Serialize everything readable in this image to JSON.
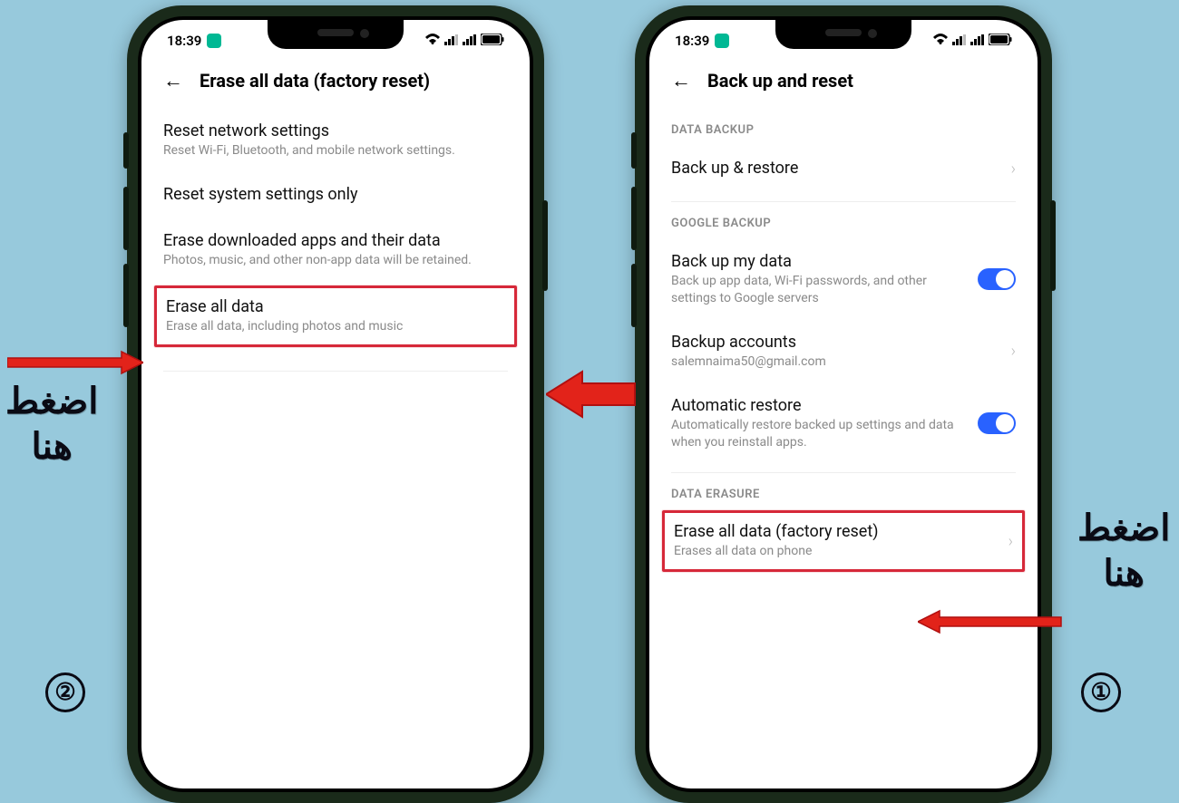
{
  "status": {
    "time": "18:39"
  },
  "phone_left": {
    "header": "Erase all data (factory reset)",
    "items": [
      {
        "title": "Reset network settings",
        "sub": "Reset Wi-Fi, Bluetooth, and mobile network settings."
      },
      {
        "title": "Reset system settings only",
        "sub": ""
      },
      {
        "title": "Erase downloaded apps and their data",
        "sub": "Photos, music, and other non-app data will be retained."
      },
      {
        "title": "Erase all data",
        "sub": "Erase all data, including photos and music"
      }
    ]
  },
  "phone_right": {
    "header": "Back up and reset",
    "sections": {
      "data_backup": "DATA BACKUP",
      "google_backup": "GOOGLE BACKUP",
      "data_erasure": "DATA ERASURE"
    },
    "backup_restore": {
      "title": "Back up & restore"
    },
    "backup_my_data": {
      "title": "Back up my data",
      "sub": "Back up app data, Wi-Fi passwords, and other settings to Google servers"
    },
    "backup_accounts": {
      "title": "Backup accounts",
      "sub": "salemnaima50@gmail.com"
    },
    "auto_restore": {
      "title": "Automatic restore",
      "sub": "Automatically restore backed up settings and data when you reinstall apps."
    },
    "erase_all": {
      "title": "Erase all data (factory reset)",
      "sub": "Erases all data on phone"
    }
  },
  "annotations": {
    "press_here": "اضغط\nهنا",
    "step1": "①",
    "step2": "②"
  }
}
